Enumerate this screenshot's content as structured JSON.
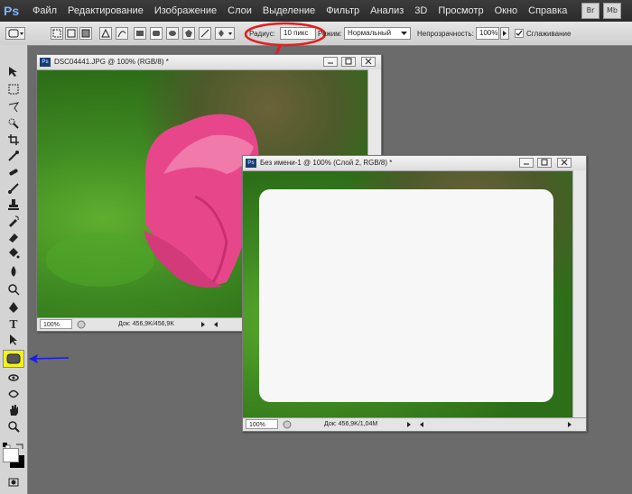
{
  "app": {
    "logo": "Ps"
  },
  "menu": [
    "Файл",
    "Редактирование",
    "Изображение",
    "Слои",
    "Выделение",
    "Фильтр",
    "Анализ",
    "3D",
    "Просмотр",
    "Окно",
    "Справка"
  ],
  "top_right_icons": [
    "Br",
    "Mb"
  ],
  "options": {
    "radius_label": "Радиус:",
    "radius_value": "10 пикс",
    "mode_label": "Режим:",
    "mode_value": "Нормальный",
    "opacity_label": "Непрозрачность:",
    "opacity_value": "100%",
    "smoothing_label": "Сглаживание",
    "smoothing_checked": true
  },
  "tools": [
    "move-icon",
    "marquee-icon",
    "lasso-icon",
    "quick-select-icon",
    "crop-icon",
    "eyedropper-icon",
    "healing-icon",
    "brush-icon",
    "stamp-icon",
    "history-brush-icon",
    "eraser-icon",
    "bucket-icon",
    "blur-icon",
    "dodge-icon",
    "pen-icon",
    "type-icon",
    "path-select-icon",
    "rounded-rectangle-icon",
    "3d-rotate-icon",
    "3d-orbit-icon",
    "hand-icon",
    "zoom-icon"
  ],
  "doc1": {
    "title": "DSC04441.JPG @ 100% (RGB/8) *",
    "zoom": "100%",
    "status": "Док: 456,9K/456,9K"
  },
  "doc2": {
    "title": "Без имени-1 @ 100% (Слой 2, RGB/8) *",
    "zoom": "100%",
    "status": "Док: 456,9K/1,04M"
  },
  "colors": {
    "highlight": "#f3f31a",
    "annotation_red": "#e02020",
    "annotation_blue": "#1a1ae6",
    "tulip_pink": "#e8468a"
  }
}
